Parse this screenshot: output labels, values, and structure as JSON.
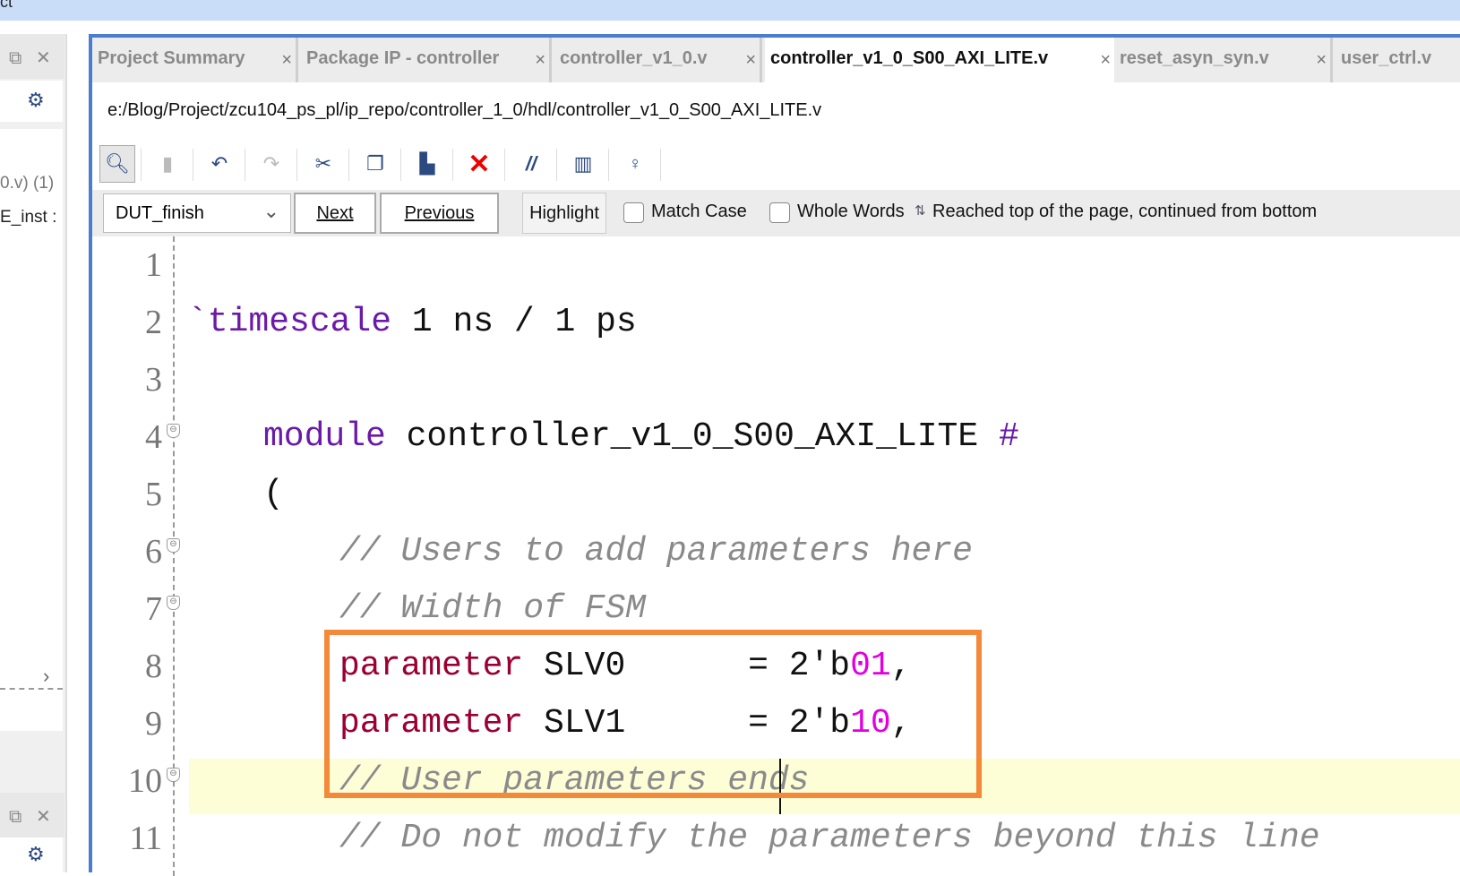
{
  "window": {
    "title_fragment": "ct"
  },
  "left_panel": {
    "text1": "0.v) (1)",
    "text2": "E_inst :"
  },
  "tabs": [
    {
      "label": "Project Summary",
      "active": false
    },
    {
      "label": "Package IP - controller",
      "active": false
    },
    {
      "label": "controller_v1_0.v",
      "active": false
    },
    {
      "label": "controller_v1_0_S00_AXI_LITE.v",
      "active": true
    },
    {
      "label": "reset_asyn_syn.v",
      "active": false
    },
    {
      "label": "user_ctrl.v",
      "active": false
    }
  ],
  "tab_close": "×",
  "file_path": "e:/Blog/Project/zcu104_ps_pl/ip_repo/controller_1_0/hdl/controller_v1_0_S00_AXI_LITE.v",
  "toolbar": [
    "search-icon",
    "save-icon",
    "undo-icon",
    "redo-icon",
    "cut-icon",
    "copy-icon",
    "paste-icon",
    "delete-icon",
    "comment-icon",
    "column-select-icon",
    "lightbulb-icon"
  ],
  "find": {
    "query": "DUT_finish",
    "next": "Next",
    "previous": "Previous",
    "highlight": "Highlight",
    "match_case": "Match Case",
    "whole_words": "Whole Words",
    "match_case_checked": false,
    "whole_words_checked": false,
    "status": "Reached top of the page, continued from bottom"
  },
  "code": {
    "line_numbers": [
      "1",
      "2",
      "3",
      "4",
      "5",
      "6",
      "7",
      "8",
      "9",
      "10",
      "11"
    ],
    "l2": {
      "kw": "`timescale",
      "rest": " 1 ns / 1 ps"
    },
    "l4": {
      "kw": "module",
      "name": " controller_v1_0_S00_AXI_LITE ",
      "hash": "#"
    },
    "l5": "(",
    "l6": "// Users to add parameters here",
    "l7": "// Width of FSM",
    "l8": {
      "kw": "parameter",
      "name": " SLV0",
      "eq": "      = 2'b",
      "val": "01",
      "end": ","
    },
    "l9": {
      "kw": "parameter",
      "name": " SLV1",
      "eq": "      = 2'b",
      "val": "10",
      "end": ","
    },
    "l10": "// User parameters ends",
    "l11": "// Do not modify the parameters beyond this line",
    "current_line": 10
  },
  "colors": {
    "accent": "#4a7ccf",
    "annotation": "#f5893a",
    "keyword": "#6a1aa8",
    "parameter": "#9b0032",
    "comment": "#8a8a8a",
    "number": "#e000e0",
    "current_line": "#fdfdd6"
  }
}
